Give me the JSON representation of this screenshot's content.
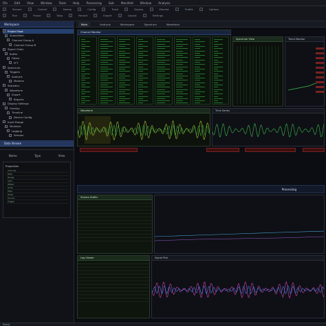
{
  "app": {
    "menu": [
      "File",
      "Edit",
      "View",
      "Window",
      "Tools",
      "Help",
      "Processing",
      "Sub",
      "Manifold",
      "Window",
      "Analysis"
    ],
    "toolbar_row1": [
      "Stream",
      "Control",
      "Sweep",
      "Config",
      "Track",
      "Deploy",
      "Monitor",
      "Profile",
      "Options"
    ],
    "toolbar_row2": [
      "Run",
      "Pause",
      "Stop",
      "Record",
      "Export",
      "Layout",
      "Settings"
    ]
  },
  "sidebar": {
    "header": "Workspace",
    "items": [
      {
        "label": "Project Root"
      },
      {
        "label": "Acquisition"
      },
      {
        "label": "Channel Group A"
      },
      {
        "label": "Channel Group B"
      },
      {
        "label": "Signal Chain"
      },
      {
        "label": "Buffer"
      },
      {
        "label": "Filters"
      },
      {
        "label": "FFT"
      },
      {
        "label": "Spectrum"
      },
      {
        "label": "Triggers"
      },
      {
        "label": "Analysis"
      },
      {
        "label": "Markers"
      },
      {
        "label": "Statistics"
      },
      {
        "label": "Waveform"
      },
      {
        "label": "Export"
      },
      {
        "label": "Reports"
      },
      {
        "label": "Display Settings"
      },
      {
        "label": "Overlay"
      },
      {
        "label": "Timeline"
      },
      {
        "label": "Device Config"
      },
      {
        "label": "Input Range"
      },
      {
        "label": "Monitors"
      },
      {
        "label": "Logging"
      },
      {
        "label": "Session"
      }
    ],
    "selected_header": "Data Stream",
    "row_labels": [
      "Name",
      "Type",
      "View"
    ],
    "mini_panel_title": "Properties",
    "mini_items": [
      "Channel",
      "Rate",
      "Range",
      "Gain",
      "Offset",
      "Units",
      "Filter",
      "Mode",
      "Source",
      "Trigger"
    ]
  },
  "main": {
    "tabs": [
      "Main",
      "Analysis",
      "Workspace",
      "Spectrum",
      "Waveform"
    ],
    "top_left_title": "Channel Monitor",
    "top_mid_title": "Spectrum View",
    "top_right_title": "Trend Monitor",
    "wave_title": "Waveform",
    "mid_right_title": "Time Series",
    "bottom_header": "Processing",
    "bottom_left_title": "Stream Buffer",
    "bottom_mid_title": "Log Viewer",
    "bottom_right_title": "Signal Plot"
  },
  "status": "Ready",
  "colors": {
    "accent": "#3fbf4a",
    "selection": "#26406f",
    "alert": "#7a2222"
  }
}
